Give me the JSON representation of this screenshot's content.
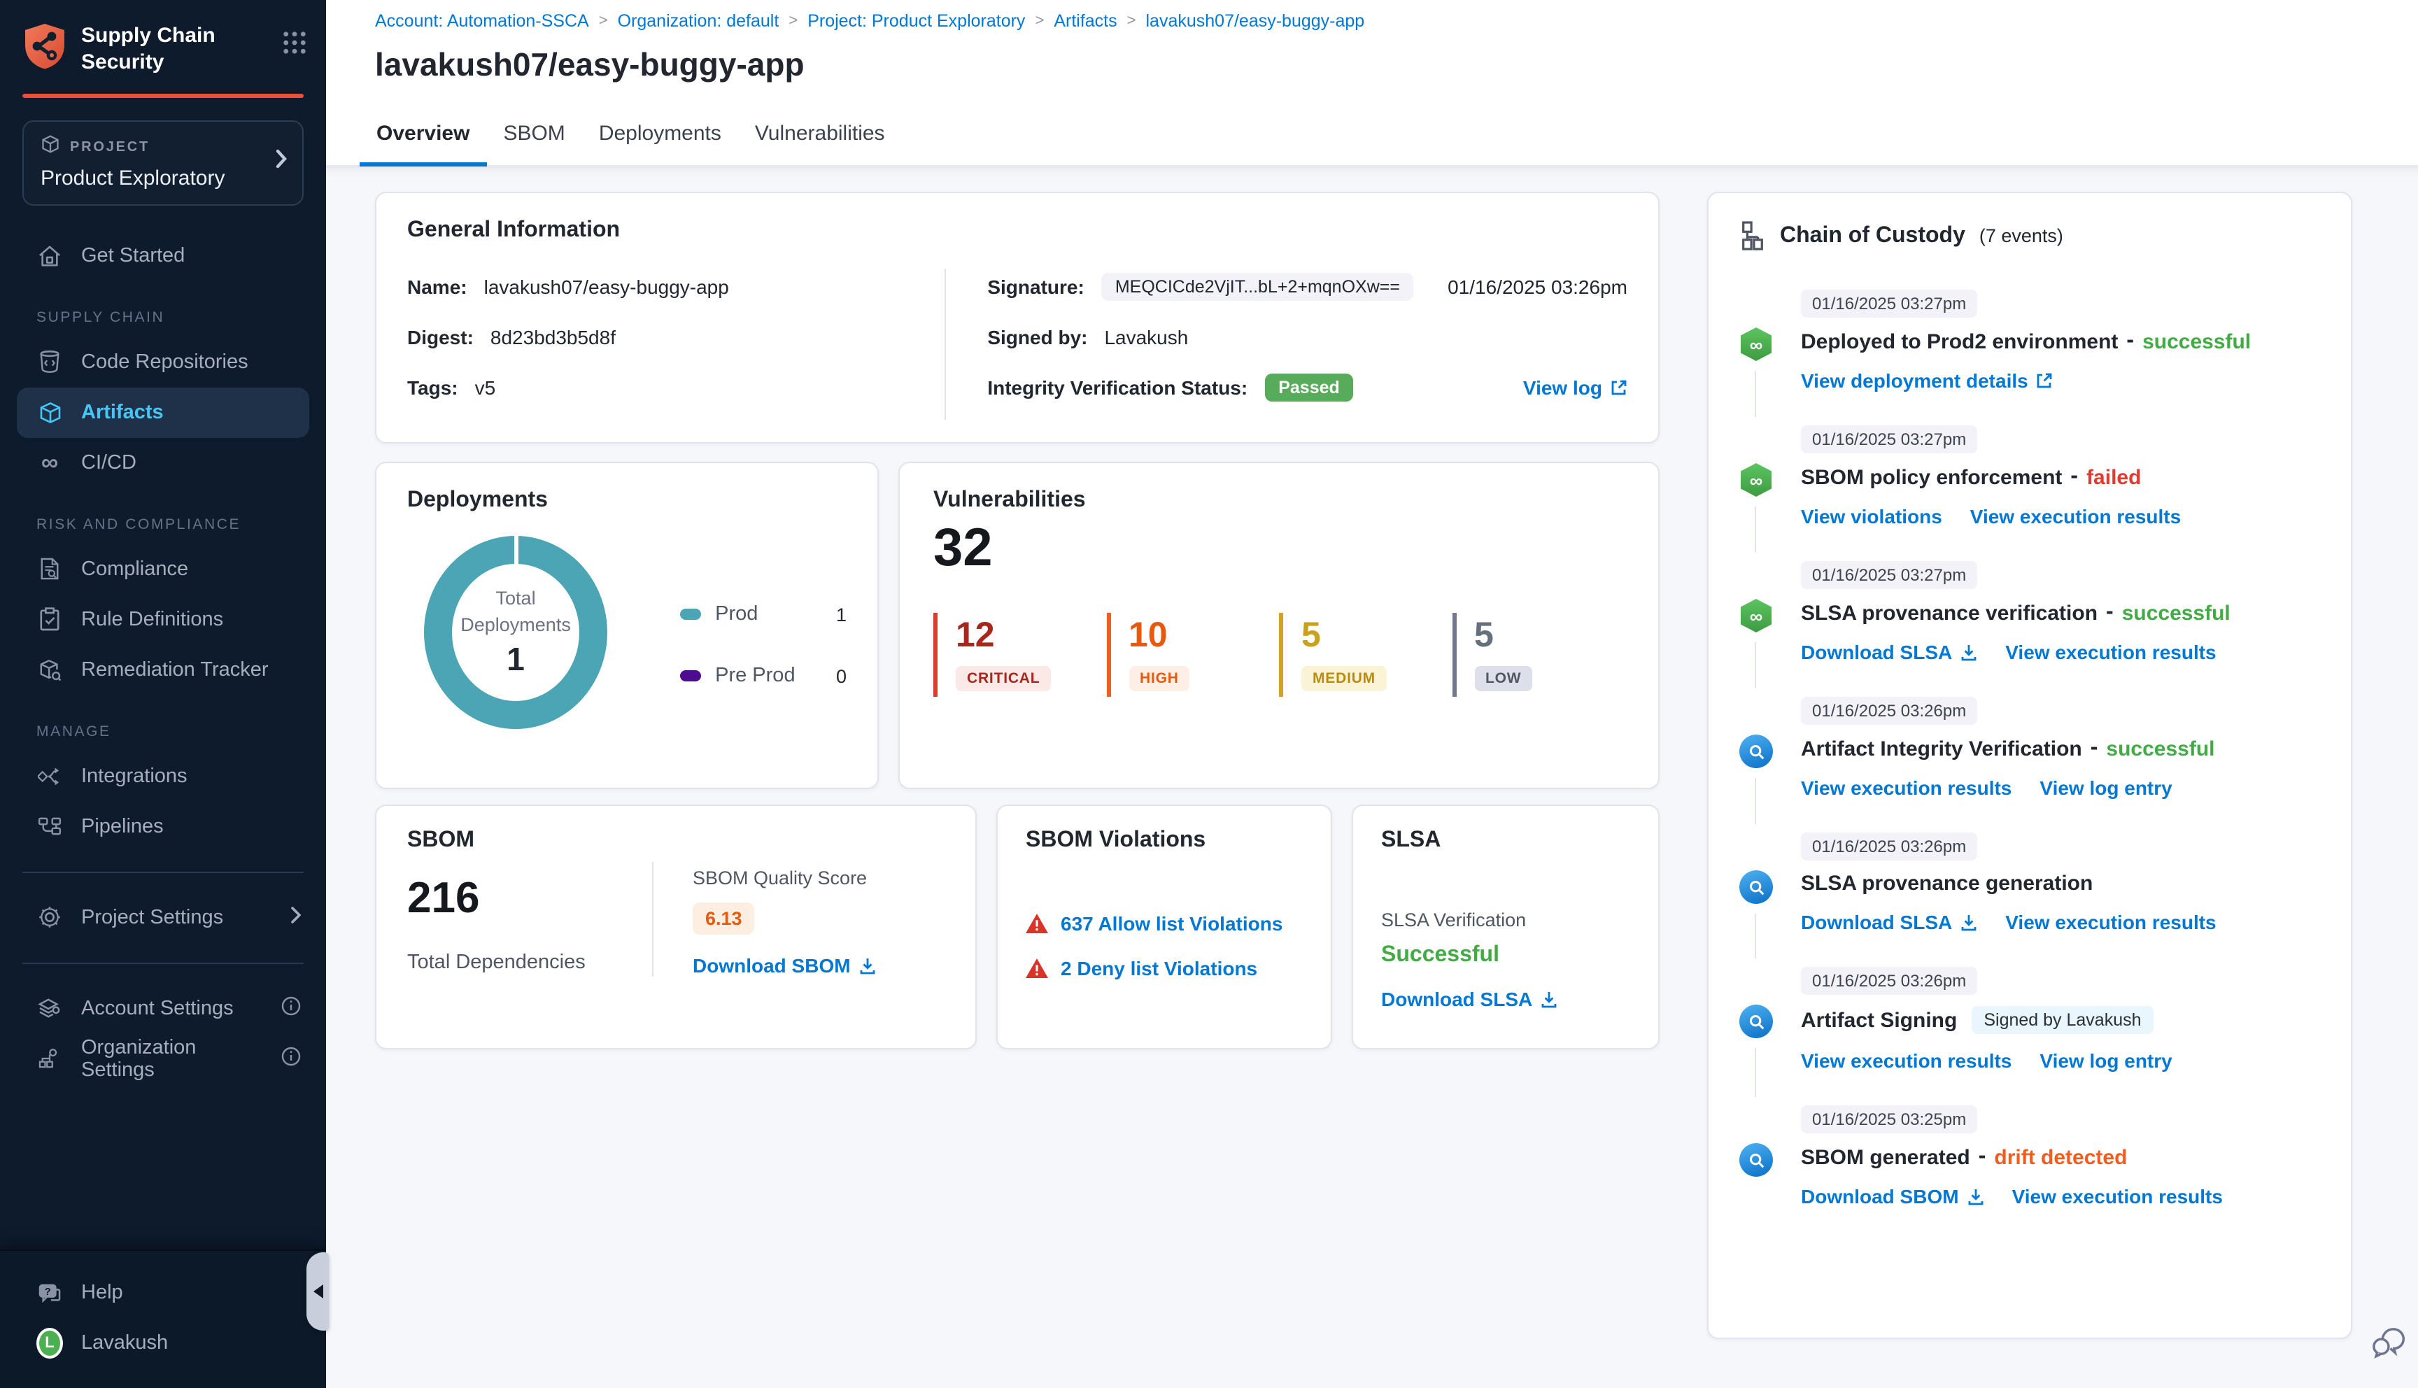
{
  "app": {
    "title": "Supply Chain Security"
  },
  "accent": {
    "primary_blue": "#0278D5",
    "success_green": "#42AB45",
    "failed_red": "#E23A2E",
    "drift_orange": "#F25C1F",
    "donut_teal": "#4BA5B5",
    "preprod_purple": "#4D0B8F",
    "brand_orange": "#E8503A",
    "sidebar_bg": "#0D1B2C",
    "active_item_blue": "#47C5F4"
  },
  "icons": {
    "logo": "shield-network",
    "app-switcher": "nine-dot-grid",
    "project": "cube",
    "get-started": "home",
    "code-repositories": "repo-cylinder",
    "artifacts": "cube",
    "cicd": "infinity",
    "compliance": "document-search",
    "rule-definitions": "clipboard-check",
    "remediation-tracker": "box-wrench",
    "integrations": "diamond-arrows",
    "pipelines": "flow-nodes",
    "project-settings": "gear",
    "account-settings": "layers-gear",
    "organization-settings": "org-gear",
    "help": "chat-question",
    "chain-header": "hierarchy",
    "event-green": "pipeline-infinity",
    "event-blue": "magnifier",
    "warning": "red-triangle-exclamation",
    "download": "download-tray",
    "external": "external-link",
    "feedback": "chat-bubbles"
  },
  "sidebar": {
    "project_label": "PROJECT",
    "project_name": "Product Exploratory",
    "get_started": "Get Started",
    "section_supply_chain": "SUPPLY CHAIN",
    "code_repositories": "Code Repositories",
    "artifacts": "Artifacts",
    "cicd": "CI/CD",
    "section_risk": "RISK AND COMPLIANCE",
    "compliance": "Compliance",
    "rule_definitions": "Rule Definitions",
    "remediation_tracker": "Remediation Tracker",
    "section_manage": "MANAGE",
    "integrations": "Integrations",
    "pipelines": "Pipelines",
    "project_settings": "Project Settings",
    "account_settings": "Account Settings",
    "organization_settings": "Organization Settings",
    "help": "Help",
    "user_name": "Lavakush",
    "avatar_initial": "L"
  },
  "header": {
    "breadcrumbs": [
      "Account: Automation-SSCA",
      "Organization: default",
      "Project: Product Exploratory",
      "Artifacts",
      "lavakush07/easy-buggy-app"
    ],
    "crumb_sep": ">",
    "title": "lavakush07/easy-buggy-app",
    "tabs": [
      "Overview",
      "SBOM",
      "Deployments",
      "Vulnerabilities"
    ],
    "active_tab": "Overview"
  },
  "general": {
    "title": "General Information",
    "name_label": "Name:",
    "name": "lavakush07/easy-buggy-app",
    "digest_label": "Digest:",
    "digest": "8d23bd3b5d8f",
    "tags_label": "Tags:",
    "tags": "v5",
    "signature_label": "Signature:",
    "signature": "MEQCICde2VjIT...bL+2+mqnOXw==",
    "signature_time": "01/16/2025 03:26pm",
    "signed_by_label": "Signed by:",
    "signed_by": "Lavakush",
    "integrity_label": "Integrity Verification Status:",
    "integrity_status": "Passed",
    "view_log": "View log"
  },
  "deployments": {
    "title": "Deployments",
    "center_label": "Total Deployments",
    "total": "1",
    "legend": [
      {
        "label": "Prod",
        "value": "1",
        "color": "#4BA5B5"
      },
      {
        "label": "Pre Prod",
        "value": "0",
        "color": "#4D0B8F"
      }
    ],
    "chart": {
      "type": "pie",
      "categories": [
        "Prod",
        "Pre Prod"
      ],
      "values": [
        1,
        0
      ],
      "title": "Total Deployments"
    }
  },
  "vulnerabilities": {
    "title": "Vulnerabilities",
    "total": "32",
    "severities": [
      {
        "label": "CRITICAL",
        "value": "12",
        "color": "#A8261C"
      },
      {
        "label": "HIGH",
        "value": "10",
        "color": "#E8590C"
      },
      {
        "label": "MEDIUM",
        "value": "5",
        "color": "#C9A11A"
      },
      {
        "label": "LOW",
        "value": "5",
        "color": "#64707D"
      }
    ]
  },
  "sbom": {
    "title": "SBOM",
    "total": "216",
    "total_label": "Total Dependencies",
    "quality_label": "SBOM Quality Score",
    "quality_score": "6.13",
    "download": "Download SBOM"
  },
  "violations": {
    "title": "SBOM Violations",
    "allow": "637 Allow list Violations",
    "deny": "2 Deny list Violations"
  },
  "slsa": {
    "title": "SLSA",
    "verification_label": "SLSA Verification",
    "verification_status": "Successful",
    "download": "Download SLSA"
  },
  "chain": {
    "title": "Chain of Custody",
    "count": "(7 events)",
    "dash": "-",
    "events": [
      {
        "time": "01/16/2025 03:27pm",
        "title": "Deployed to Prod2 environment",
        "status": "successful",
        "links": [
          "View deployment details"
        ]
      },
      {
        "time": "01/16/2025 03:27pm",
        "title": "SBOM policy enforcement",
        "status": "failed",
        "links": [
          "View violations",
          "View execution results"
        ]
      },
      {
        "time": "01/16/2025 03:27pm",
        "title": "SLSA provenance verification",
        "status": "successful",
        "links": [
          "Download SLSA",
          "View execution results"
        ]
      },
      {
        "time": "01/16/2025 03:26pm",
        "title": "Artifact Integrity Verification",
        "status": "successful",
        "links": [
          "View execution results",
          "View log entry"
        ]
      },
      {
        "time": "01/16/2025 03:26pm",
        "title": "SLSA provenance generation",
        "status": "",
        "links": [
          "Download SLSA",
          "View execution results"
        ]
      },
      {
        "time": "01/16/2025 03:26pm",
        "title": "Artifact Signing",
        "badge": "Signed by Lavakush",
        "links": [
          "View execution results",
          "View log entry"
        ]
      },
      {
        "time": "01/16/2025 03:25pm",
        "title": "SBOM generated",
        "status": "drift detected",
        "links": [
          "Download SBOM",
          "View execution results"
        ]
      }
    ]
  }
}
